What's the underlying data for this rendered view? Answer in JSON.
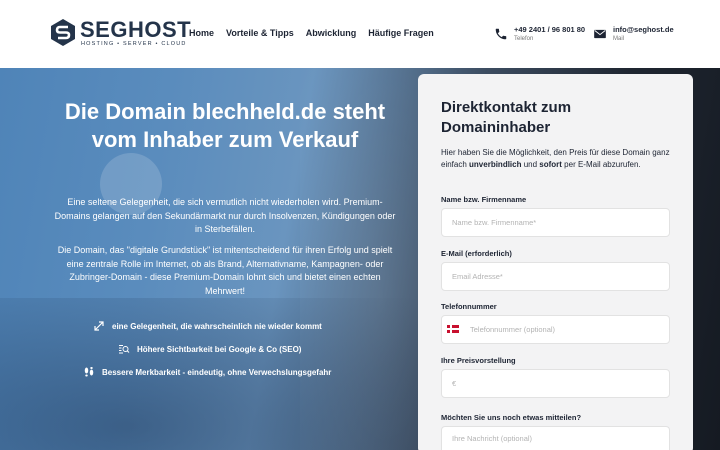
{
  "brand": {
    "name": "SEGHOST",
    "tagline": "HOSTING • SERVER • CLOUD",
    "color": "#24344a"
  },
  "nav": {
    "items": [
      "Home",
      "Vorteile & Tipps",
      "Abwicklung",
      "Häufige Fragen"
    ]
  },
  "contact": {
    "phone": "+49 2401 / 96 801 80",
    "phone_label": "Telefon",
    "email": "info@seghost.de",
    "email_label": "Mail"
  },
  "hero": {
    "title": "Die Domain blechheld.de steht vom Inhaber zum Verkauf",
    "paragraph1": "Eine seltene Gelegenheit, die sich vermutlich nicht wiederholen wird. Premium-Domains gelangen auf den Sekundärmarkt nur durch Insolvenzen, Kündigungen oder in Sterbefällen.",
    "paragraph2": "Die Domain, das \"digitale Grundstück\" ist mitentscheidend für ihren Erfolg und spielt eine zentrale Rolle im Internet, ob als Brand, Alternativname, Kampagnen- oder Zubringer-Domain - diese Premium-Domain lohnt sich und bietet einen echten Mehrwert!",
    "features": [
      {
        "icon": "arrows-icon",
        "text": "eine Gelegenheit, die wahrscheinlich nie wieder kommt"
      },
      {
        "icon": "search-list-icon",
        "text": "Höhere Sichtbarkeit bei Google & Co (SEO)"
      },
      {
        "icon": "footprints-icon",
        "text": "Bessere Merkbarkeit - eindeutig, ohne Verwechslungsgefahr"
      }
    ]
  },
  "form": {
    "title": "Direktkontakt zum Domaininhaber",
    "intro_pre": "Hier haben Sie die Möglichkeit, den Preis für diese Domain ganz einfach ",
    "intro_bold1": "unverbindlich",
    "intro_mid": " und ",
    "intro_bold2": "sofort",
    "intro_post": " per E-Mail abzurufen.",
    "fields": {
      "name": {
        "label": "Name bzw. Firmenname",
        "placeholder": "Name bzw. Firmenname*"
      },
      "email": {
        "label": "E-Mail (erforderlich)",
        "placeholder": "Email Adresse*"
      },
      "phone": {
        "label": "Telefonnummer",
        "placeholder": "Telefonnummer (optional)"
      },
      "price": {
        "label": "Ihre Preisvorstellung",
        "placeholder": "€"
      },
      "message": {
        "label": "Möchten Sie uns noch etwas mitteilen?",
        "placeholder": "Ihre Nachricht (optional)"
      }
    }
  }
}
